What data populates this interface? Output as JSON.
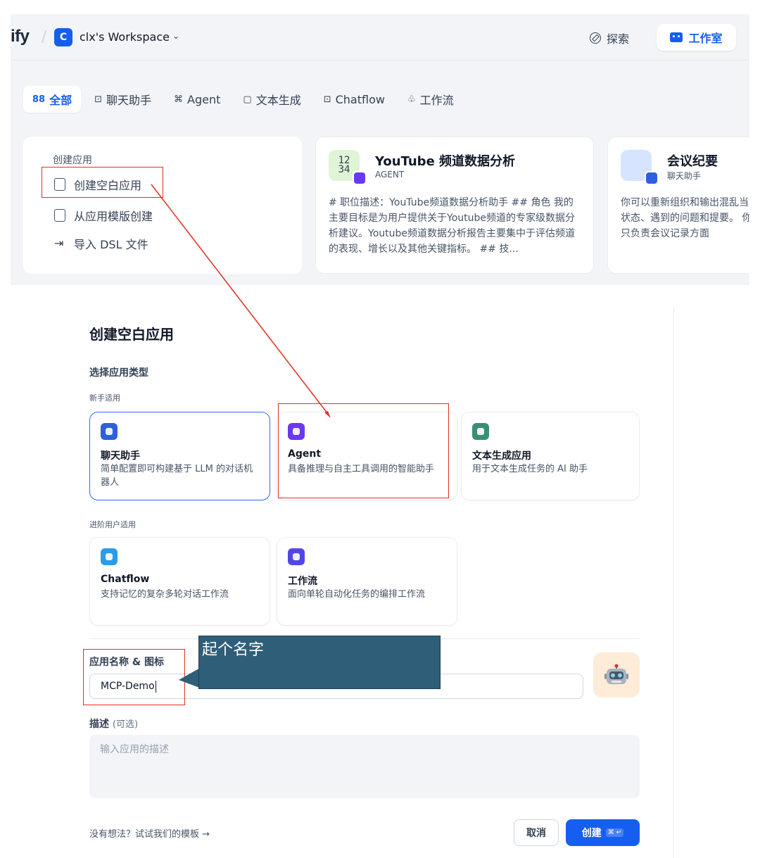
{
  "header": {
    "logo": "ify",
    "workspace_initial": "C",
    "workspace_name": "clx's Workspace",
    "chevron": "⌄",
    "explore_label": "探索",
    "studio_label": "工作室"
  },
  "tabs": [
    {
      "label": "全部",
      "icon": "grid-icon",
      "glyph": "88"
    },
    {
      "label": "聊天助手",
      "icon": "chat-icon",
      "glyph": "⊡"
    },
    {
      "label": "Agent",
      "icon": "agent-icon",
      "glyph": "⌘"
    },
    {
      "label": "文本生成",
      "icon": "doc-icon",
      "glyph": "▢"
    },
    {
      "label": "Chatflow",
      "icon": "chatflow-icon",
      "glyph": "⊡"
    },
    {
      "label": "工作流",
      "icon": "workflow-icon",
      "glyph": "♧"
    }
  ],
  "create_card": {
    "title": "创建应用",
    "items": [
      "创建空白应用",
      "从应用模版创建",
      "导入 DSL 文件"
    ]
  },
  "app_cards": [
    {
      "name": "YouTube 频道数据分析",
      "type": "AGENT",
      "icon_text": "12\n34",
      "description": "# 职位描述：YouTube频道数据分析助手 ## 角色 我的主要目标是为用户提供关于Youtube频道的专家级数据分析建议。Youtube频道数据分析报告主要集中于评估频道的表现、增长以及其他关键指标。 ## 技..."
    },
    {
      "name": "会议纪要",
      "type": "聊天助手",
      "icon_text": "",
      "description": "你可以重新组织和输出混乱当前状态、遇到的问题和提要。 你只负责会议记录方面"
    }
  ],
  "modal": {
    "title": "创建空白应用",
    "select_type_label": "选择应用类型",
    "beginner_label": "新手适用",
    "advanced_label": "进阶用户适用",
    "types": [
      {
        "name": "聊天助手",
        "desc": "简单配置即可构建基于 LLM 的对话机器人",
        "color": "#2f5fe0"
      },
      {
        "name": "Agent",
        "desc": "具备推理与自主工具调用的智能助手",
        "color": "#6938ef"
      },
      {
        "name": "文本生成应用",
        "desc": "用于文本生成任务的 AI 助手",
        "color": "#3a8e76"
      },
      {
        "name": "Chatflow",
        "desc": "支持记忆的复杂多轮对话工作流",
        "color": "#2d9be6"
      },
      {
        "name": "工作流",
        "desc": "面向单轮自动化任务的编排工作流",
        "color": "#5147e6"
      }
    ],
    "name_label": "应用名称 & 图标",
    "name_value": "MCP-Demo",
    "emoji": "🤖",
    "desc_label": "描述",
    "desc_optional": "(可选)",
    "desc_placeholder": "输入应用的描述",
    "template_link": "没有想法？试试我们的模板 →",
    "cancel_label": "取消",
    "create_label": "创建",
    "create_kbd": "⌘ ↵"
  },
  "annotation": {
    "callout_text": "起个名字",
    "highlight_color": "#e0301e",
    "callout_color": "#2f5f78"
  }
}
